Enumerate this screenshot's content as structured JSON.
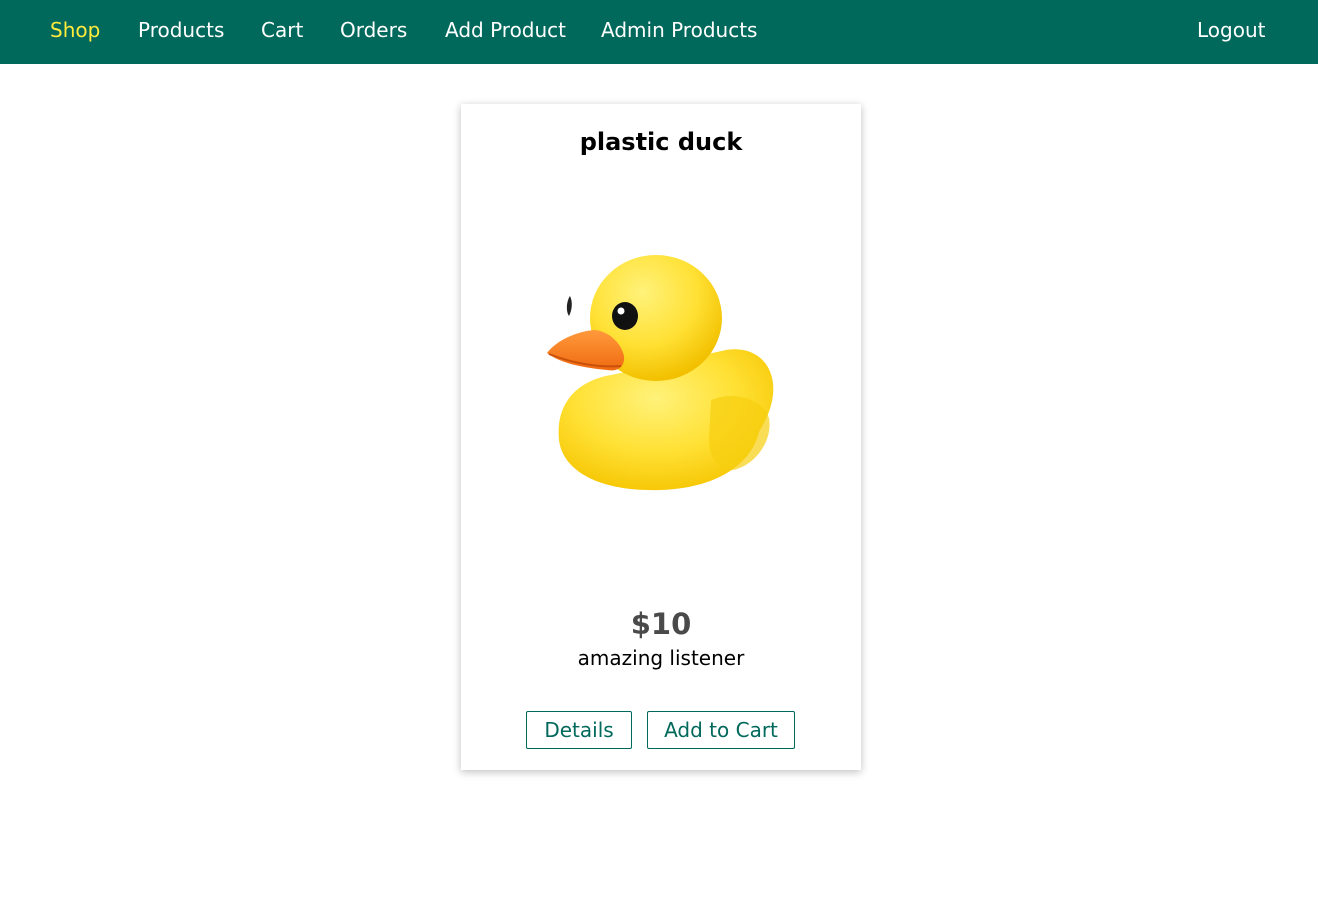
{
  "header": {
    "background_color": "#00695c",
    "active_color": "#ffeb3b",
    "nav_items": [
      {
        "label": "Shop",
        "active": true
      },
      {
        "label": "Products"
      },
      {
        "label": "Cart"
      },
      {
        "label": "Orders"
      },
      {
        "label": "Add Product"
      },
      {
        "label": "Admin Products"
      }
    ],
    "logout_label": "Logout"
  },
  "product": {
    "title": "plastic duck",
    "image_icon": "rubber-duck-image",
    "price": "$10",
    "description": "amazing listener",
    "details_label": "Details",
    "add_to_cart_label": "Add to Cart"
  }
}
